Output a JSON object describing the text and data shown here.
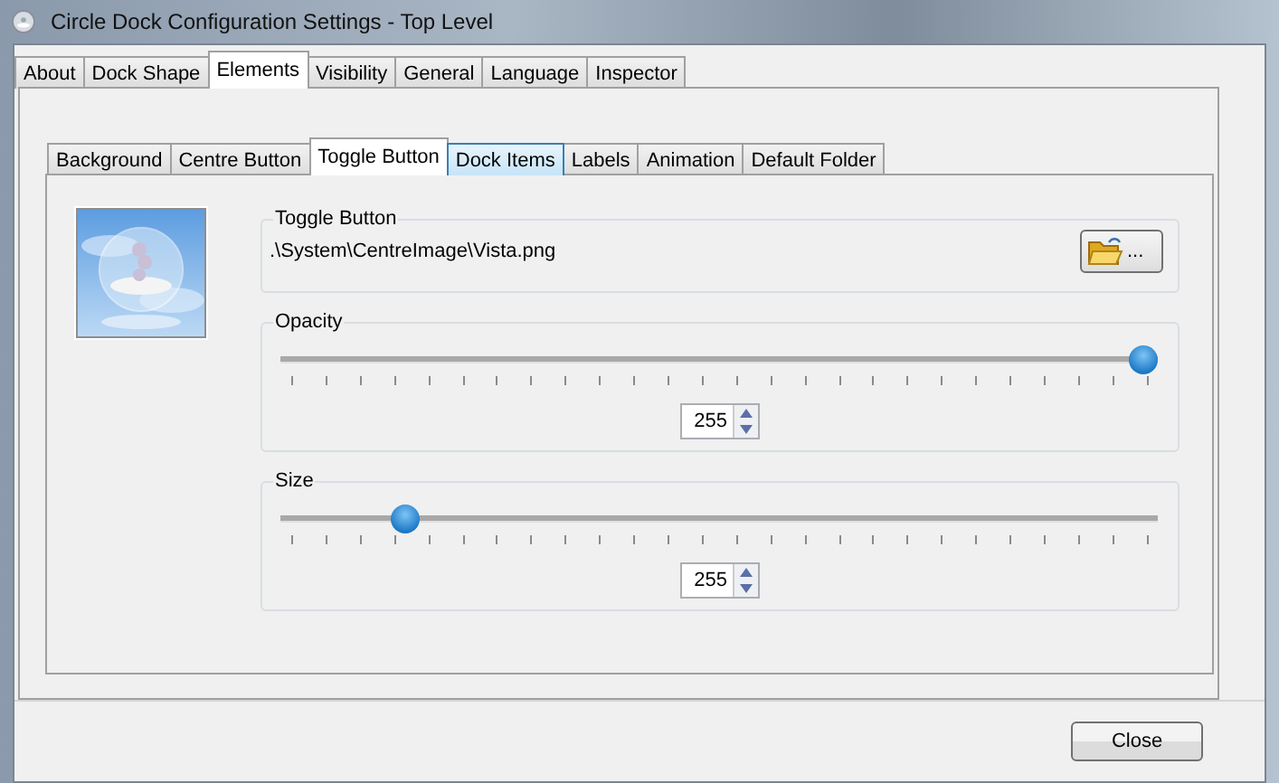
{
  "window": {
    "title": "Circle Dock Configuration Settings - Top Level"
  },
  "tabs": [
    {
      "label": "About",
      "selected": false
    },
    {
      "label": "Dock Shape",
      "selected": false
    },
    {
      "label": "Elements",
      "selected": true
    },
    {
      "label": "Visibility",
      "selected": false
    },
    {
      "label": "General",
      "selected": false
    },
    {
      "label": "Language",
      "selected": false
    },
    {
      "label": "Inspector",
      "selected": false
    }
  ],
  "subtabs": [
    {
      "label": "Background",
      "selected": false,
      "hovered": false
    },
    {
      "label": "Centre Button",
      "selected": false,
      "hovered": false
    },
    {
      "label": "Toggle Button",
      "selected": true,
      "hovered": false
    },
    {
      "label": "Dock Items",
      "selected": false,
      "hovered": true
    },
    {
      "label": "Labels",
      "selected": false,
      "hovered": false
    },
    {
      "label": "Animation",
      "selected": false,
      "hovered": false
    },
    {
      "label": "Default Folder",
      "selected": false,
      "hovered": false
    }
  ],
  "preview": {
    "kind": "picture"
  },
  "file_group": {
    "title": "Toggle Button",
    "path": ".\\System\\CentreImage\\Vista.png",
    "browse_label": "..."
  },
  "sliders": [
    {
      "title": "Opacity",
      "level": 1.0,
      "value": "255"
    },
    {
      "title": "Size",
      "level": 0.13,
      "value": "255"
    }
  ],
  "buttons": [
    "Close"
  ]
}
